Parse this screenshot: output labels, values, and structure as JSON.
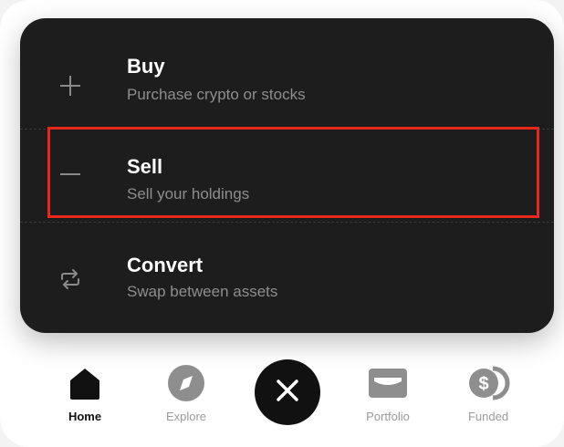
{
  "menu": {
    "items": [
      {
        "icon": "plus-icon",
        "title": "Buy",
        "subtitle": "Purchase crypto or stocks"
      },
      {
        "icon": "minus-icon",
        "title": "Sell",
        "subtitle": "Sell your holdings"
      },
      {
        "icon": "swap-arrows-icon",
        "title": "Convert",
        "subtitle": "Swap between assets"
      }
    ],
    "highlighted_item": "Sell",
    "highlight_color": "#e8281b"
  },
  "fab": {
    "icon": "close-icon"
  },
  "tabbar": {
    "tabs": [
      {
        "icon": "home-icon",
        "label": "Home",
        "active": true
      },
      {
        "icon": "compass-icon",
        "label": "Explore",
        "active": false
      },
      {
        "icon": "wallet-icon",
        "label": "Portfolio",
        "active": false
      },
      {
        "icon": "coins-icon",
        "label": "Funded",
        "active": false
      }
    ]
  },
  "colors": {
    "sheet_background": "#1d1d1d",
    "active_icon": "#111111",
    "inactive_icon": "#8e8e8e"
  }
}
